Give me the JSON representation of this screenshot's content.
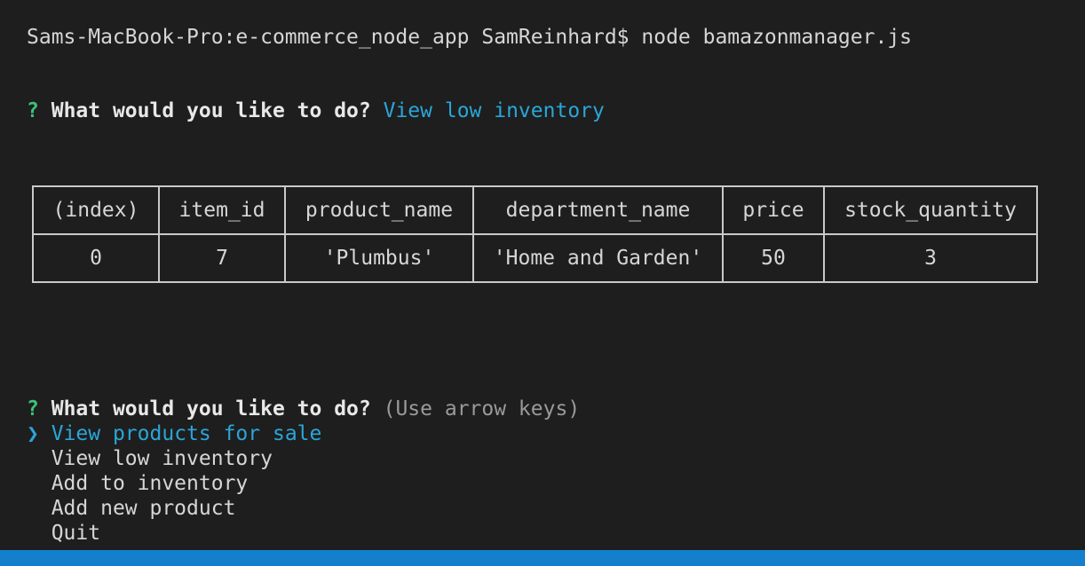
{
  "prompt_line": {
    "host": "Sams-MacBook-Pro:e-commerce_node_app SamReinhard$",
    "command": "node bamazonmanager.js"
  },
  "first_question": {
    "mark": "?",
    "question": "What would you like to do?",
    "answer": "View low inventory"
  },
  "table": {
    "headers": [
      "(index)",
      "item_id",
      "product_name",
      "department_name",
      "price",
      "stock_quantity"
    ],
    "rows": [
      [
        "0",
        "7",
        "'Plumbus'",
        "'Home and Garden'",
        "50",
        "3"
      ]
    ]
  },
  "second_question": {
    "mark": "?",
    "question": "What would you like to do?",
    "hint": "(Use arrow keys)",
    "pointer": "❯",
    "options": [
      "View products for sale",
      "View low inventory",
      "Add to inventory",
      "Add new product",
      "Quit"
    ]
  },
  "colors": {
    "background": "#1e1e1e",
    "accent_blue": "#2aa6d8",
    "question_mark_green": "#3dc27a",
    "number_yellow": "#e6dc2c",
    "string_green": "#2fbf6f",
    "status_bar": "#147fcc"
  }
}
